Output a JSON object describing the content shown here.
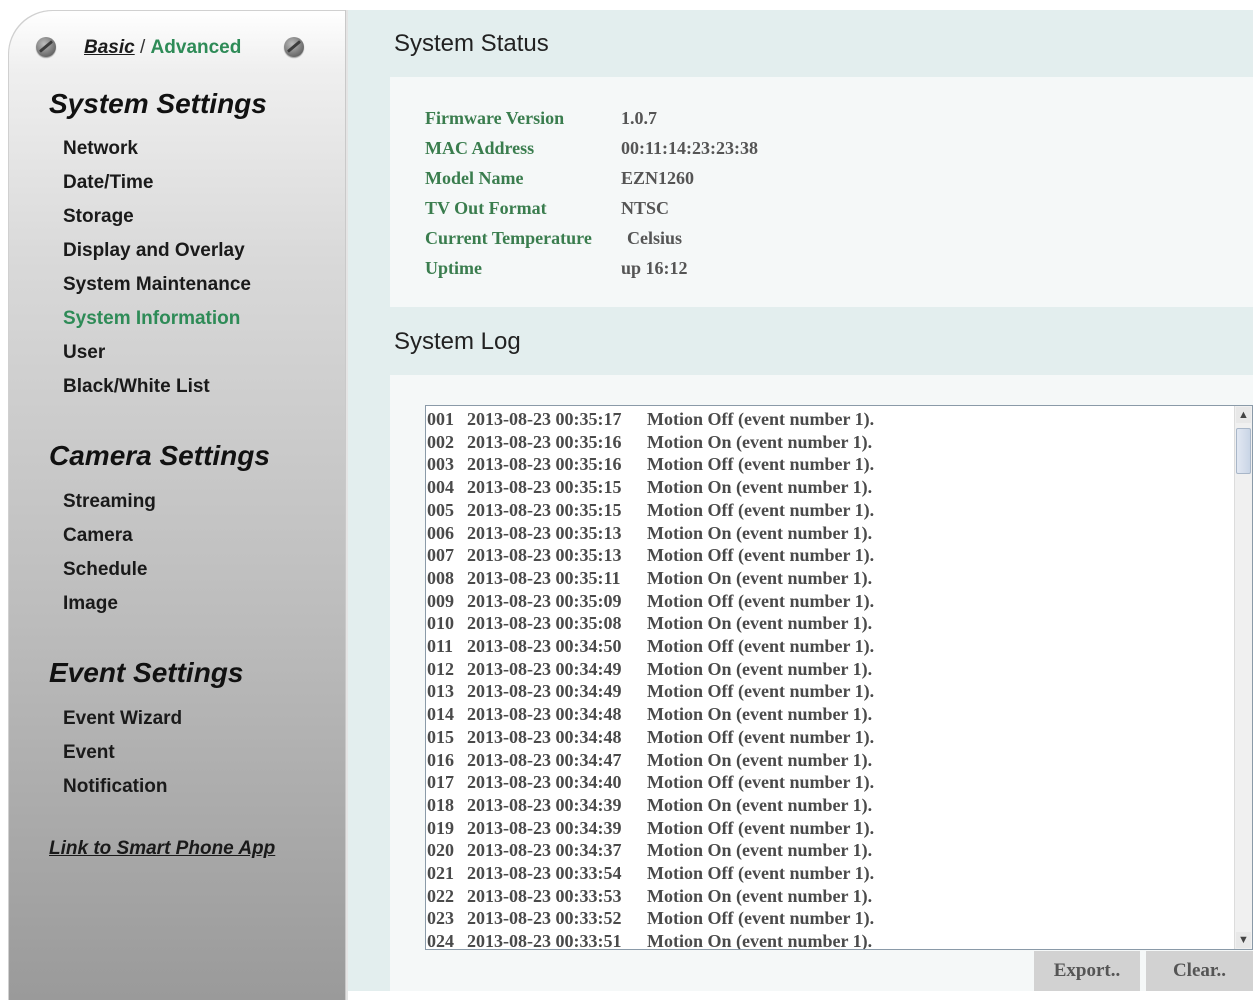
{
  "sidebar": {
    "mode_basic": "Basic",
    "mode_sep": " / ",
    "mode_advanced": "Advanced",
    "sections": [
      {
        "title": "System Settings"
      },
      {
        "title": "Camera Settings"
      },
      {
        "title": "Event Settings"
      }
    ],
    "system_items": [
      "Network",
      "Date/Time",
      "Storage",
      "Display and Overlay",
      "System Maintenance",
      "System Information",
      "User",
      "Black/White List"
    ],
    "camera_items": [
      "Streaming",
      "Camera",
      "Schedule",
      "Image"
    ],
    "event_items": [
      "Event Wizard",
      "Event",
      "Notification"
    ],
    "active_item": "System Information",
    "smart_link": "Link to Smart Phone App"
  },
  "status": {
    "title": "System Status",
    "rows": [
      {
        "label": "Firmware Version",
        "value": "1.0.7"
      },
      {
        "label": "MAC Address",
        "value": "00:11:14:23:23:38"
      },
      {
        "label": "Model Name",
        "value": "EZN1260"
      },
      {
        "label": "TV Out Format",
        "value": "NTSC"
      },
      {
        "label": "Current Temperature",
        "value": "Celsius"
      },
      {
        "label": "Uptime",
        "value": "up 16:12"
      }
    ]
  },
  "log": {
    "title": "System Log",
    "entries": [
      {
        "num": "001",
        "ts": "2013-08-23 00:35:17",
        "msg": "Motion Off (event number 1)."
      },
      {
        "num": "002",
        "ts": "2013-08-23 00:35:16",
        "msg": "Motion On (event number 1)."
      },
      {
        "num": "003",
        "ts": "2013-08-23 00:35:16",
        "msg": "Motion Off (event number 1)."
      },
      {
        "num": "004",
        "ts": "2013-08-23 00:35:15",
        "msg": "Motion On (event number 1)."
      },
      {
        "num": "005",
        "ts": "2013-08-23 00:35:15",
        "msg": "Motion Off (event number 1)."
      },
      {
        "num": "006",
        "ts": "2013-08-23 00:35:13",
        "msg": "Motion On (event number 1)."
      },
      {
        "num": "007",
        "ts": "2013-08-23 00:35:13",
        "msg": "Motion Off (event number 1)."
      },
      {
        "num": "008",
        "ts": "2013-08-23 00:35:11",
        "msg": "Motion On (event number 1)."
      },
      {
        "num": "009",
        "ts": "2013-08-23 00:35:09",
        "msg": "Motion Off (event number 1)."
      },
      {
        "num": "010",
        "ts": "2013-08-23 00:35:08",
        "msg": "Motion On (event number 1)."
      },
      {
        "num": "011",
        "ts": "2013-08-23 00:34:50",
        "msg": "Motion Off (event number 1)."
      },
      {
        "num": "012",
        "ts": "2013-08-23 00:34:49",
        "msg": "Motion On (event number 1)."
      },
      {
        "num": "013",
        "ts": "2013-08-23 00:34:49",
        "msg": "Motion Off (event number 1)."
      },
      {
        "num": "014",
        "ts": "2013-08-23 00:34:48",
        "msg": "Motion On (event number 1)."
      },
      {
        "num": "015",
        "ts": "2013-08-23 00:34:48",
        "msg": "Motion Off (event number 1)."
      },
      {
        "num": "016",
        "ts": "2013-08-23 00:34:47",
        "msg": "Motion On (event number 1)."
      },
      {
        "num": "017",
        "ts": "2013-08-23 00:34:40",
        "msg": "Motion Off (event number 1)."
      },
      {
        "num": "018",
        "ts": "2013-08-23 00:34:39",
        "msg": "Motion On (event number 1)."
      },
      {
        "num": "019",
        "ts": "2013-08-23 00:34:39",
        "msg": "Motion Off (event number 1)."
      },
      {
        "num": "020",
        "ts": "2013-08-23 00:34:37",
        "msg": "Motion On (event number 1)."
      },
      {
        "num": "021",
        "ts": "2013-08-23 00:33:54",
        "msg": "Motion Off (event number 1)."
      },
      {
        "num": "022",
        "ts": "2013-08-23 00:33:53",
        "msg": "Motion On (event number 1)."
      },
      {
        "num": "023",
        "ts": "2013-08-23 00:33:52",
        "msg": "Motion Off (event number 1)."
      },
      {
        "num": "024",
        "ts": "2013-08-23 00:33:51",
        "msg": "Motion On (event number 1)."
      }
    ],
    "export_label": "Export..",
    "clear_label": "Clear..",
    "scroll_up_icon": "chevron-up-icon",
    "scroll_down_icon": "chevron-down-icon"
  }
}
